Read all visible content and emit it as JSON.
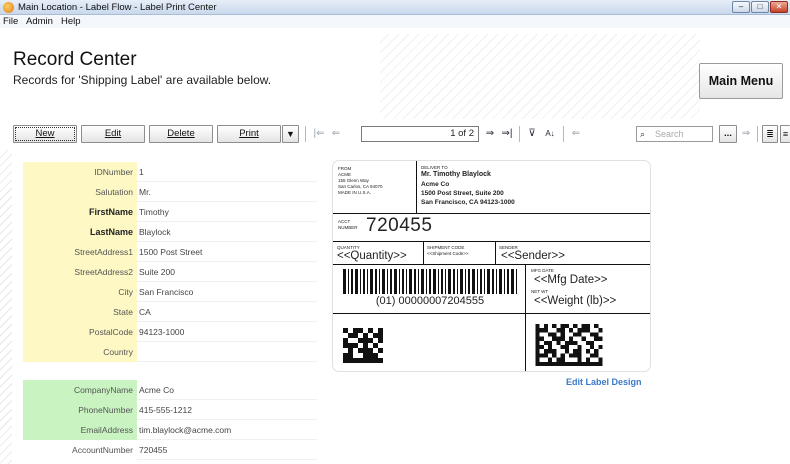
{
  "window": {
    "title": "Main Location - Label Flow - Label Print Center"
  },
  "menu": [
    "File",
    "Admin",
    "Help"
  ],
  "header": {
    "title": "Record Center",
    "subtitle": "Records for 'Shipping Label' are available below.",
    "main_menu": "Main Menu"
  },
  "toolbar": {
    "new": "New",
    "edit": "Edit",
    "delete": "Delete",
    "print": "Print",
    "record_position": "1 of 2",
    "search_placeholder": "Search",
    "more": "..."
  },
  "fields": [
    {
      "label": "IDNumber",
      "value": "1"
    },
    {
      "label": "Salutation",
      "value": "Mr."
    },
    {
      "label": "FirstName",
      "value": "Timothy"
    },
    {
      "label": "LastName",
      "value": "Blaylock"
    },
    {
      "label": "StreetAddress1",
      "value": "1500 Post Street"
    },
    {
      "label": "StreetAddress2",
      "value": "Suite 200"
    },
    {
      "label": "City",
      "value": "San Francisco"
    },
    {
      "label": "State",
      "value": "CA"
    },
    {
      "label": "PostalCode",
      "value": "94123-1000"
    },
    {
      "label": "Country",
      "value": ""
    }
  ],
  "fields2": [
    {
      "label": "CompanyName",
      "value": "Acme Co"
    },
    {
      "label": "PhoneNumber",
      "value": "415-555-1212"
    },
    {
      "label": "EmailAddress",
      "value": "tim.blaylock@acme.com"
    },
    {
      "label": "AccountNumber",
      "value": "720455"
    }
  ],
  "label": {
    "from_caption": "FROM",
    "from_lines": [
      "ACME",
      "155 Glenn Way",
      "San Carlos, CA 94070",
      "MADE IN U.S.A."
    ],
    "deliver_caption": "DELIVER TO",
    "deliver_lines": [
      "Mr. Timothy Blaylock",
      "Acme Co",
      "1500 Post Street, Suite 200",
      "San Francisco, CA 94123-1000"
    ],
    "acct_caption_1": "ACCT",
    "acct_caption_2": "NUMBER",
    "acct_number": "720455",
    "qty_caption": "QUANTITY",
    "qty_value": "<<Quantity>>",
    "ship_caption": "SHIPMENT CODE",
    "ship_value": "<<Shipment Code>>",
    "sender_caption": "SENDER",
    "sender_value": "<<Sender>>",
    "barcode_text": "(01) 00000007204555",
    "mfg_caption": "MFG DATE",
    "mfg_value": "<<Mfg Date>>",
    "net_caption": "NET WT",
    "net_value": "<<Weight (lb)>>"
  },
  "edit_label_design": "Edit Label Design",
  "colors": {
    "required_label": "#fdf8c4",
    "company_label": "#c9f4c2",
    "link": "#3b78c9"
  }
}
